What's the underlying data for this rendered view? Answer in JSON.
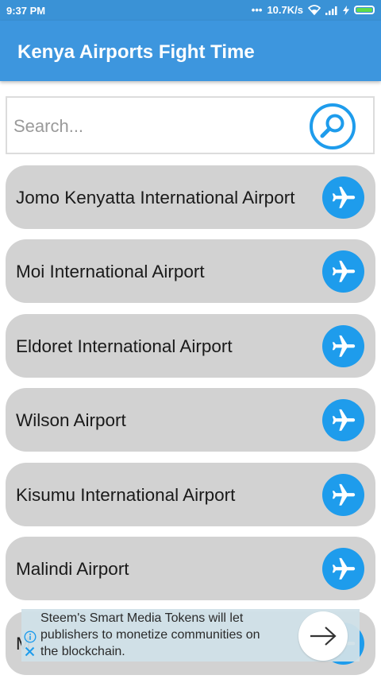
{
  "status": {
    "time": "9:37 PM",
    "speed": "10.7K/s"
  },
  "app": {
    "title": "Kenya Airports Fight Time"
  },
  "search": {
    "placeholder": "Search..."
  },
  "airports": [
    "Jomo Kenyatta International Airport",
    "Moi International Airport",
    "Eldoret International Airport",
    "Wilson Airport",
    "Kisumu International Airport",
    "Malindi Airport",
    "M"
  ],
  "ad": {
    "line1": "Steem's Smart Media Tokens will let",
    "line2": "publishers to monetize communities on",
    "line3": "the blockchain."
  },
  "colors": {
    "app_bar": "#3d96de",
    "plane_button": "#1e9cec",
    "list_item_bg": "#d2d2d2",
    "search_icon": "#1e9cec"
  }
}
